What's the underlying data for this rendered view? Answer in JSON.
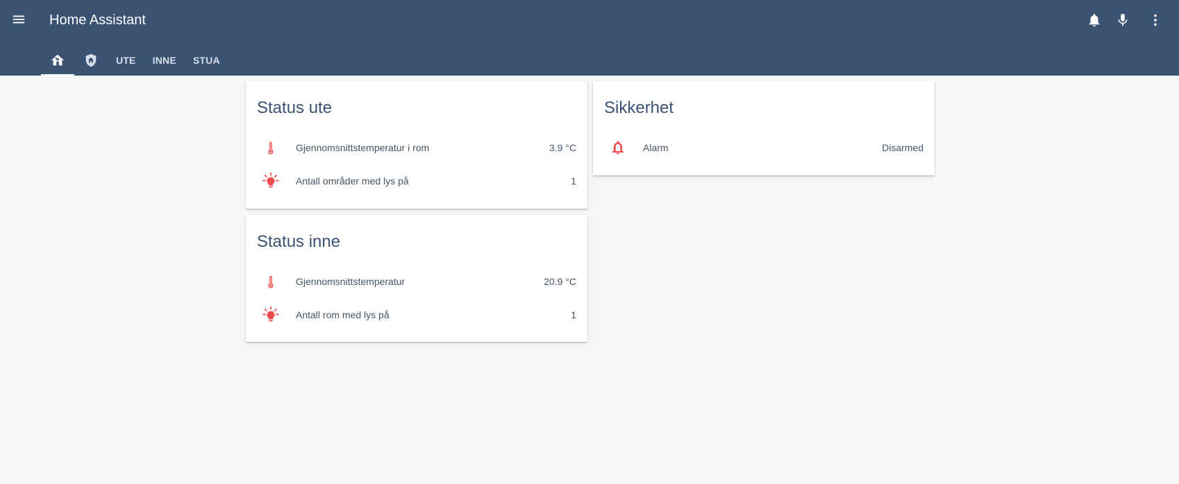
{
  "header": {
    "title": "Home Assistant",
    "menu_icon": "menu-icon",
    "actions": [
      {
        "name": "notifications",
        "icon": "bell-icon"
      },
      {
        "name": "voice",
        "icon": "microphone-icon"
      },
      {
        "name": "more",
        "icon": "more-vert-icon"
      }
    ],
    "tabs": [
      {
        "type": "icon",
        "icon": "home-icon",
        "active": true
      },
      {
        "type": "icon",
        "icon": "shield-home-icon",
        "active": false
      },
      {
        "type": "text",
        "label": "UTE",
        "active": false
      },
      {
        "type": "text",
        "label": "INNE",
        "active": false
      },
      {
        "type": "text",
        "label": "STUA",
        "active": false
      }
    ]
  },
  "cards": {
    "status_ute": {
      "title": "Status ute",
      "rows": [
        {
          "icon": "thermometer-icon",
          "label": "Gjennomsnittstemperatur i rom",
          "value": "3.9 °C"
        },
        {
          "icon": "lightbulb-icon",
          "label": "Antall områder med lys på",
          "value": "1"
        }
      ]
    },
    "status_inne": {
      "title": "Status inne",
      "rows": [
        {
          "icon": "thermometer-icon",
          "label": "Gjennomsnittstemperatur",
          "value": "20.9 °C"
        },
        {
          "icon": "lightbulb-icon",
          "label": "Antall rom med lys på",
          "value": "1"
        }
      ]
    },
    "sikkerhet": {
      "title": "Sikkerhet",
      "rows": [
        {
          "icon": "bell-outline-icon",
          "label": "Alarm",
          "value": "Disarmed"
        }
      ]
    }
  },
  "colors": {
    "header_bg": "#3b5373",
    "page_bg": "#f5f6f8",
    "icon_accent": "#f04a4a",
    "card_title": "#3b5373",
    "text": "#445566"
  }
}
